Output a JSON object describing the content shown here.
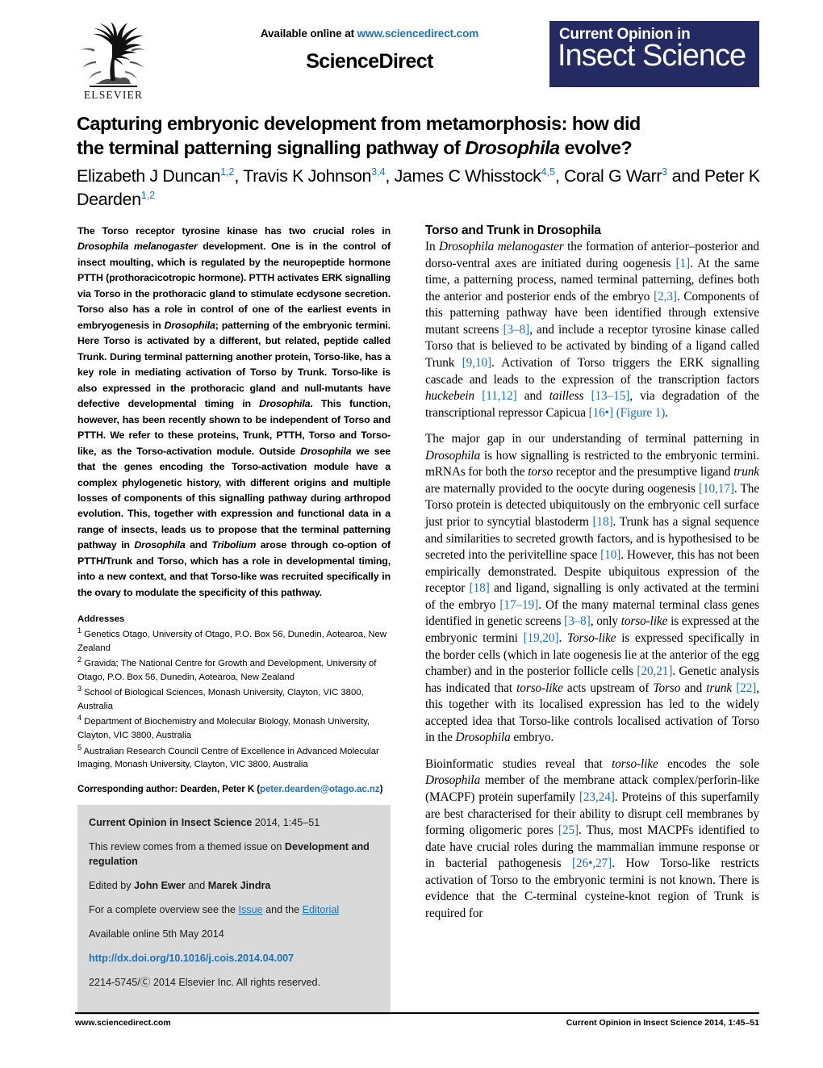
{
  "header": {
    "publisher_name": "ELSEVIER",
    "available_online_prefix": "Available online at ",
    "available_online_url": "www.sciencedirect.com",
    "sciencedirect_wordmark": "ScienceDirect",
    "journal_logo_line1": "Current Opinion in",
    "journal_logo_line2": "Insect Science",
    "journal_logo_color": "#242a62",
    "link_color": "#1b72b8"
  },
  "article": {
    "title_line1": "Capturing embryonic development from metamorphosis: how did",
    "title_line2_pre": "the terminal patterning signalling pathway of ",
    "title_line2_italic": "Drosophila",
    "title_line2_post": " evolve?",
    "authors": [
      {
        "name": "Elizabeth J Duncan",
        "affil": "1,2",
        "sep": ", "
      },
      {
        "name": "Travis K Johnson",
        "affil": "3,4",
        "sep": ", "
      },
      {
        "name": "James C Whisstock",
        "affil": "4,5",
        "sep": ", "
      },
      {
        "name": "Coral G Warr",
        "affil": "3",
        "sep": " and "
      },
      {
        "name": "Peter K Dearden",
        "affil": "1,2",
        "sep": ""
      }
    ]
  },
  "abstract": {
    "text": "The Torso receptor tyrosine kinase has two crucial roles in Drosophila melanogaster development. One is in the control of insect moulting, which is regulated by the neuropeptide hormone PTTH (prothoracicotropic hormone). PTTH activates ERK signalling via Torso in the prothoracic gland to stimulate ecdysone secretion. Torso also has a role in control of one of the earliest events in embryogenesis in Drosophila; patterning of the embryonic termini. Here Torso is activated by a different, but related, peptide called Trunk. During terminal patterning another protein, Torso-like, has a key role in mediating activation of Torso by Trunk. Torso-like is also expressed in the prothoracic gland and null-mutants have defective developmental timing in Drosophila. This function, however, has been recently shown to be independent of Torso and PTTH. We refer to these proteins, Trunk, PTTH, Torso and Torso-like, as the Torso-activation module. Outside Drosophila we see that the genes encoding the Torso-activation module have a complex phylogenetic history, with different origins and multiple losses of components of this signalling pathway during arthropod evolution. This, together with expression and functional data in a range of insects, leads us to propose that the terminal patterning pathway in Drosophila and Tribolium arose through co-option of PTTH/Trunk and Torso, which has a role in developmental timing, into a new context, and that Torso-like was recruited specifically in the ovary to modulate the specificity of this pathway."
  },
  "addresses": {
    "heading": "Addresses",
    "items": [
      {
        "marker": "1",
        "text": "Genetics Otago, University of Otago, P.O. Box 56, Dunedin, Aotearoa, New Zealand"
      },
      {
        "marker": "2",
        "text": "Gravida; The National Centre for Growth and Development, University of Otago, P.O. Box 56, Dunedin, Aotearoa, New Zealand"
      },
      {
        "marker": "3",
        "text": "School of Biological Sciences, Monash University, Clayton, VIC 3800, Australia"
      },
      {
        "marker": "4",
        "text": "Department of Biochemistry and Molecular Biology, Monash University, Clayton, VIC 3800, Australia"
      },
      {
        "marker": "5",
        "text": "Australian Research Council Centre of Excellence in Advanced Molecular Imaging, Monash University, Clayton, VIC 3800, Australia"
      }
    ]
  },
  "corresponding": {
    "label": "Corresponding author: Dearden, Peter K (",
    "email": "peter.dearden@otago.ac.nz",
    "close": ")"
  },
  "infobox": {
    "citation_journal": "Current Opinion in Insect Science",
    "citation_rest": " 2014, 1:45–51",
    "themed_prefix": "This review comes from a themed issue on ",
    "themed_bold": "Development and regulation",
    "edited_prefix": "Edited by ",
    "edited_a": "John Ewer",
    "edited_mid": " and ",
    "edited_b": "Marek Jindra",
    "overview_prefix": "For a complete overview see the ",
    "overview_link1": "Issue",
    "overview_mid": " and the ",
    "overview_link2": "Editorial",
    "available_online": "Available online 5th May 2014",
    "doi": "http://dx.doi.org/10.1016/j.cois.2014.04.007",
    "issn_line_pre": "2214-5745/",
    "issn_copyright": "Ⓒ",
    "issn_line_post": " 2014 Elsevier Inc. All rights reserved.",
    "background_color": "#d9d9d9"
  },
  "main": {
    "section_heading": "Torso and Trunk in Drosophila",
    "paragraphs": [
      "In <i>Drosophila melanogaster</i> the formation of anterior–posterior and dorso-ventral axes are initiated during oogenesis <r>[1]</r>. At the same time, a patterning process, named terminal patterning, defines both the anterior and posterior ends of the embryo <r>[2,3]</r>. Components of this patterning pathway have been identified through extensive mutant screens <r>[3–8]</r>, and include a receptor tyrosine kinase called Torso that is believed to be activated by binding of a ligand called Trunk <r>[9,10]</r>. Activation of Torso triggers the ERK signalling cascade and leads to the expression of the transcription factors <i>huckebein</i> <r>[11,12]</r> and <i>tailless</i> <r>[13–15]</r>, via degradation of the transcriptional repressor Capicua <r>[16•]</r> <r>(Figure 1)</r>.",
      "The major gap in our understanding of terminal patterning in <i>Drosophila</i> is how signalling is restricted to the embryonic termini. mRNAs for both the <i>torso</i> receptor and the presumptive ligand <i>trunk</i> are maternally provided to the oocyte during oogenesis <r>[10,17]</r>. The Torso protein is detected ubiquitously on the embryonic cell surface just prior to syncytial blastoderm <r>[18]</r>. Trunk has a signal sequence and similarities to secreted growth factors, and is hypothesised to be secreted into the perivitelline space <r>[10]</r>. However, this has not been empirically demonstrated. Despite ubiquitous expression of the receptor <r>[18]</r> and ligand, signalling is only activated at the termini of the embryo <r>[17–19]</r>. Of the many maternal terminal class genes identified in genetic screens <r>[3–8]</r>, only <i>torso-like</i> is expressed at the embryonic termini <r>[19,20]</r>. <i>Torso-like</i> is expressed specifically in the border cells (which in late oogenesis lie at the anterior of the egg chamber) and in the posterior follicle cells <r>[20,21]</r>. Genetic analysis has indicated that <i>torso-like</i> acts upstream of <i>Torso</i> and <i>trunk</i> <r>[22]</r>, this together with its localised expression has led to the widely accepted idea that Torso-like controls localised activation of Torso in the <i>Drosophila</i> embryo.",
      "Bioinformatic studies reveal that <i>torso-like</i> encodes the sole <i>Drosophila</i> member of the membrane attack complex/perforin-like (MACPF) protein superfamily <r>[23,24]</r>. Proteins of this superfamily are best characterised for their ability to disrupt cell membranes by forming oligomeric pores <r>[25]</r>. Thus, most MACPFs identified to date have crucial roles during the mammalian immune response or in bacterial pathogenesis <r>[26•,27]</r>. How Torso-like restricts activation of Torso to the embryonic termini is not known. There is evidence that the C-terminal cysteine-knot region of Trunk is required for"
    ]
  },
  "footer": {
    "left": "www.sciencedirect.com",
    "right_journal": "Current Opinion in Insect Science",
    "right_rest": " 2014, 1:45–51"
  }
}
